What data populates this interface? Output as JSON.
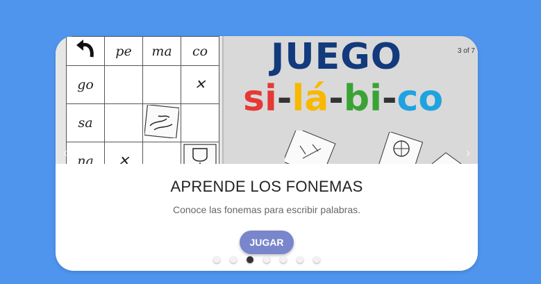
{
  "slide": {
    "counter": "3 of 7",
    "grid": {
      "header": [
        "pe",
        "ma",
        "co"
      ],
      "rows": [
        {
          "label": "go",
          "cells": [
            "",
            "",
            "✕"
          ]
        },
        {
          "label": "sa",
          "cells": [
            "",
            "",
            ""
          ]
        },
        {
          "label": "na",
          "cells": [
            "✕",
            "",
            ""
          ]
        }
      ]
    },
    "title_line1": "JUEGO",
    "title_line2": [
      {
        "text": "si",
        "color": "#e53935"
      },
      {
        "text": "-",
        "color": "#333333"
      },
      {
        "text": "lá",
        "color": "#f9b800"
      },
      {
        "text": "-",
        "color": "#333333"
      },
      {
        "text": "bi",
        "color": "#3aa335"
      },
      {
        "text": "-",
        "color": "#333333"
      },
      {
        "text": "co",
        "color": "#1ea3e0"
      }
    ]
  },
  "card": {
    "title": "APRENDE LOS FONEMAS",
    "description": "Conoce las fonemas para escribir palabras.",
    "play_label": "JUGAR"
  },
  "pagination": {
    "total": 7,
    "active": 2
  },
  "colors": {
    "background": "#4f95ee",
    "button": "#7986cb",
    "title_blue": "#123a7c"
  }
}
